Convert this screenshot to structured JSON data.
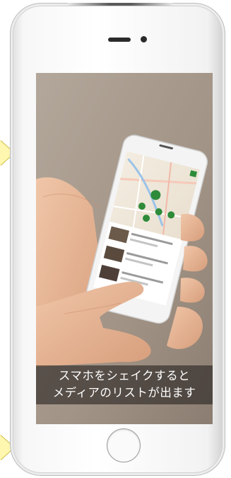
{
  "caption": {
    "line1": "スマホをシェイクすると",
    "line2": "メディアのリストが出ます"
  },
  "colors": {
    "arrow_fill": "#fff6b0",
    "map_marker": "#2e8b3a",
    "caption_bg": "rgba(40,36,34,0.62)",
    "caption_text": "#ffffff"
  },
  "icons": [
    "speaker-slot-icon",
    "front-camera-icon",
    "home-button-icon",
    "map-pin-icon",
    "list-menu-icon"
  ]
}
